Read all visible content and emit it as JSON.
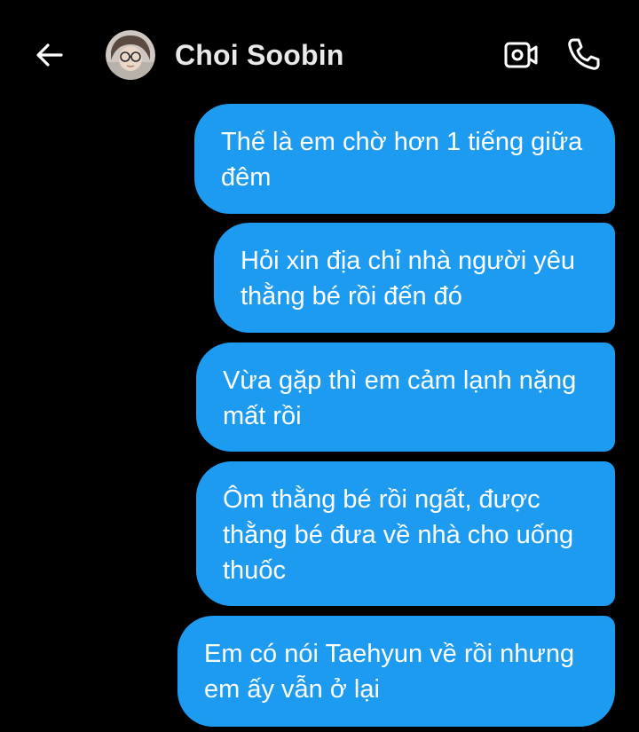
{
  "header": {
    "back_icon": "arrow-left-icon",
    "contact_name": "Choi Soobin",
    "video_icon": "video-camera-icon",
    "call_icon": "phone-icon"
  },
  "theme": {
    "background": "#000000",
    "bubble_color": "#1d9bf0",
    "text_color": "#ffffff"
  },
  "messages": [
    {
      "text": "Thế là em chờ hơn 1 tiếng giữa\nđêm"
    },
    {
      "text": "Hỏi xin địa chỉ nhà người yêu\nthằng bé rồi đến đó"
    },
    {
      "text": "Vừa gặp thì em cảm lạnh nặng\nmất rồi"
    },
    {
      "text": "Ôm thằng bé rồi ngất, được\nthằng bé đưa về nhà cho uống\nthuốc"
    },
    {
      "text": "Em có nói Taehyun về rồi nhưng\nem ấy vẫn ở lại"
    }
  ]
}
